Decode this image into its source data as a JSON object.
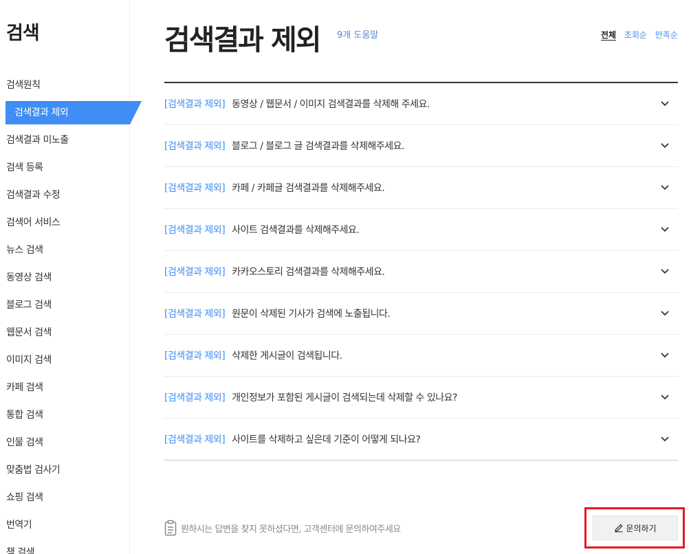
{
  "sidebar": {
    "title": "검색",
    "items": [
      {
        "label": "검색원칙"
      },
      {
        "label": "검색결과 제외",
        "active": true
      },
      {
        "label": "검색결과 미노출"
      },
      {
        "label": "검색 등록"
      },
      {
        "label": "검색결과 수정"
      },
      {
        "label": "검색어 서비스"
      },
      {
        "label": "뉴스 검색"
      },
      {
        "label": "동영상 검색"
      },
      {
        "label": "블로그 검색"
      },
      {
        "label": "웹문서 검색"
      },
      {
        "label": "이미지 검색"
      },
      {
        "label": "카페 검색"
      },
      {
        "label": "통합 검색"
      },
      {
        "label": "인물 검색"
      },
      {
        "label": "맞춤법 검사기"
      },
      {
        "label": "쇼핑 검색"
      },
      {
        "label": "번역기"
      },
      {
        "label": "책 검색"
      }
    ]
  },
  "header": {
    "title": "검색결과 제외",
    "help_count": "9개 도움말"
  },
  "sort": {
    "options": [
      "전체",
      "조회순",
      "만족순"
    ],
    "selected": "전체"
  },
  "faq": {
    "category_label": "[검색결과 제외]",
    "items": [
      {
        "question": "동영상 / 웹문서 / 이미지 검색결과를 삭제해 주세요."
      },
      {
        "question": "블로그 / 블로그 글 검색결과를 삭제해주세요."
      },
      {
        "question": "카페 / 카페글 검색결과를 삭제해주세요."
      },
      {
        "question": "사이트 검색결과를 삭제해주세요."
      },
      {
        "question": "카카오스토리 검색결과를 삭제해주세요."
      },
      {
        "question": "원문이 삭제된 기사가 검색에 노출됩니다."
      },
      {
        "question": "삭제한 게시글이 검색됩니다."
      },
      {
        "question": "개인정보가 포함된 게시글이 검색되는데 삭제할 수 있나요?"
      },
      {
        "question": "사이트를 삭제하고 싶은데 기준이 어떻게 되나요?"
      }
    ]
  },
  "footer": {
    "notice": "원하시는 답변을 찾지 못하셨다면, 고객센터에 문의하여주세요",
    "inquiry_button": "문의하기"
  },
  "colors": {
    "accent": "#3f8df5",
    "highlight_box": "#e8161c"
  },
  "icons": {
    "expand": "chevron-down-icon",
    "notice": "clipboard-icon",
    "inquiry": "pencil-icon"
  }
}
